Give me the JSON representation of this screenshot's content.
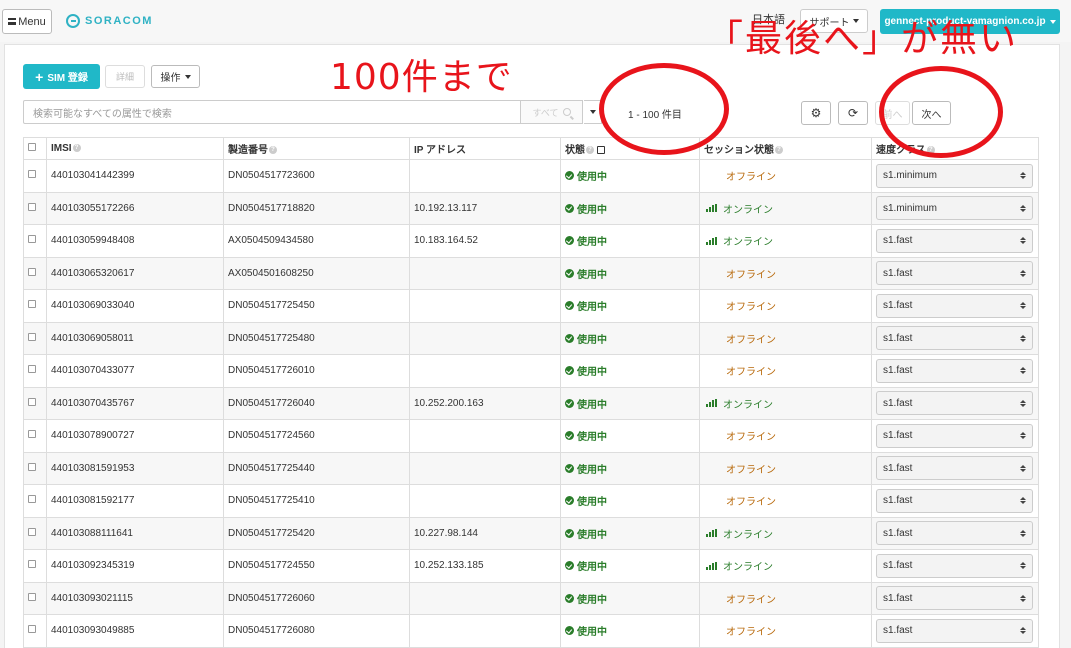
{
  "header": {
    "menu_label": "Menu",
    "logo_text": "SORACOM",
    "language": "日本語",
    "support": "サポート",
    "account": "gennect-product-yamagnion.co.jp"
  },
  "toolbar": {
    "register_label": "SIM 登録",
    "detail_label": "詳細",
    "actions_label": "操作",
    "search_placeholder": "検索可能なすべての属性で検索",
    "search_scope": "すべて",
    "page_info": "1 - 100 件目",
    "prev_label": "前へ",
    "next_label": "次へ"
  },
  "table": {
    "headers": {
      "imsi": "IMSI",
      "serial": "製造番号",
      "ip": "IP アドレス",
      "status": "状態",
      "session": "セッション状態",
      "speed": "速度クラス"
    },
    "rows": [
      {
        "imsi": "440103041442399",
        "serial": "DN0504517723600",
        "ip": "",
        "status": "使用中",
        "session": "オフライン",
        "online": false,
        "speed": "s1.minimum"
      },
      {
        "imsi": "440103055172266",
        "serial": "DN0504517718820",
        "ip": "10.192.13.117",
        "status": "使用中",
        "session": "オンライン",
        "online": true,
        "speed": "s1.minimum"
      },
      {
        "imsi": "440103059948408",
        "serial": "AX0504509434580",
        "ip": "10.183.164.52",
        "status": "使用中",
        "session": "オンライン",
        "online": true,
        "speed": "s1.fast"
      },
      {
        "imsi": "440103065320617",
        "serial": "AX0504501608250",
        "ip": "",
        "status": "使用中",
        "session": "オフライン",
        "online": false,
        "speed": "s1.fast"
      },
      {
        "imsi": "440103069033040",
        "serial": "DN0504517725450",
        "ip": "",
        "status": "使用中",
        "session": "オフライン",
        "online": false,
        "speed": "s1.fast"
      },
      {
        "imsi": "440103069058011",
        "serial": "DN0504517725480",
        "ip": "",
        "status": "使用中",
        "session": "オフライン",
        "online": false,
        "speed": "s1.fast"
      },
      {
        "imsi": "440103070433077",
        "serial": "DN0504517726010",
        "ip": "",
        "status": "使用中",
        "session": "オフライン",
        "online": false,
        "speed": "s1.fast"
      },
      {
        "imsi": "440103070435767",
        "serial": "DN0504517726040",
        "ip": "10.252.200.163",
        "status": "使用中",
        "session": "オンライン",
        "online": true,
        "speed": "s1.fast"
      },
      {
        "imsi": "440103078900727",
        "serial": "DN0504517724560",
        "ip": "",
        "status": "使用中",
        "session": "オフライン",
        "online": false,
        "speed": "s1.fast"
      },
      {
        "imsi": "440103081591953",
        "serial": "DN0504517725440",
        "ip": "",
        "status": "使用中",
        "session": "オフライン",
        "online": false,
        "speed": "s1.fast"
      },
      {
        "imsi": "440103081592177",
        "serial": "DN0504517725410",
        "ip": "",
        "status": "使用中",
        "session": "オフライン",
        "online": false,
        "speed": "s1.fast"
      },
      {
        "imsi": "440103088111641",
        "serial": "DN0504517725420",
        "ip": "10.227.98.144",
        "status": "使用中",
        "session": "オンライン",
        "online": true,
        "speed": "s1.fast"
      },
      {
        "imsi": "440103092345319",
        "serial": "DN0504517724550",
        "ip": "10.252.133.185",
        "status": "使用中",
        "session": "オンライン",
        "online": true,
        "speed": "s1.fast"
      },
      {
        "imsi": "440103093021115",
        "serial": "DN0504517726060",
        "ip": "",
        "status": "使用中",
        "session": "オフライン",
        "online": false,
        "speed": "s1.fast"
      },
      {
        "imsi": "440103093049885",
        "serial": "DN0504517726080",
        "ip": "",
        "status": "使用中",
        "session": "オフライン",
        "online": false,
        "speed": "s1.fast"
      }
    ]
  },
  "annotations": {
    "note_count": "100件まで",
    "note_last": "「最後へ」が無い"
  },
  "colors": {
    "accent": "#20b8c8",
    "in_use": "#2a7d2a",
    "offline": "#b8690b",
    "annotation": "#e8141b"
  }
}
